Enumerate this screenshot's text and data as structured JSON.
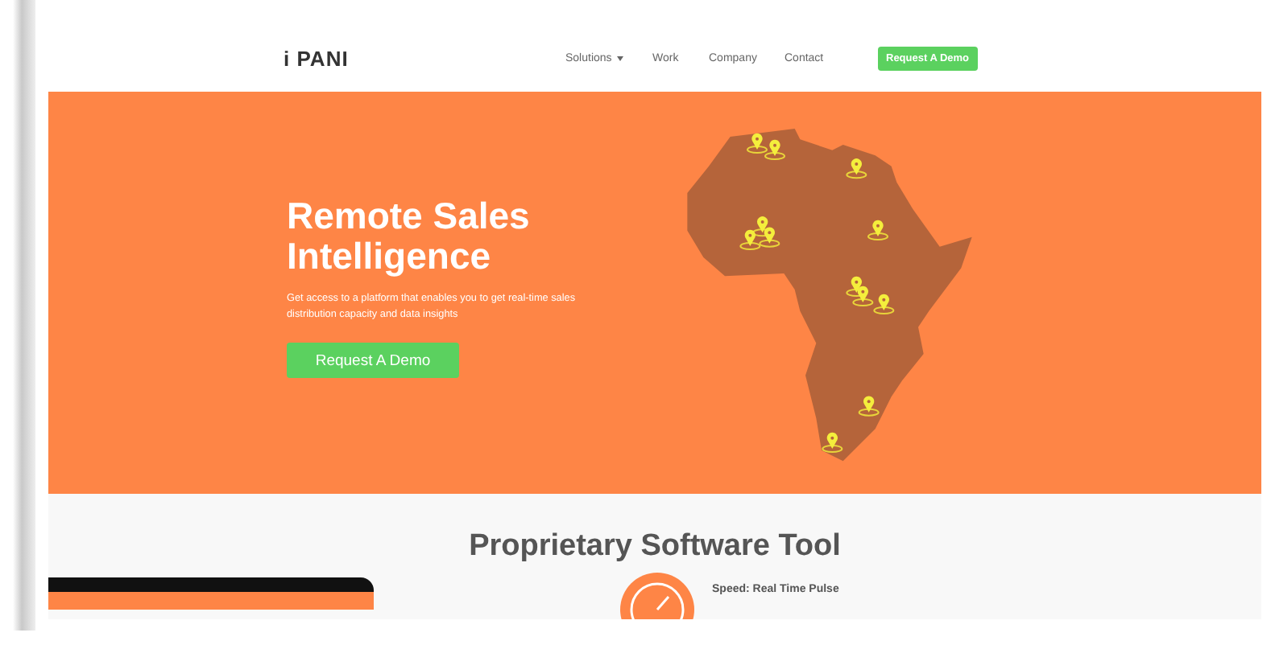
{
  "header": {
    "logo": "i PANI",
    "nav": [
      {
        "label": "Solutions",
        "dropdown": true
      },
      {
        "label": "Work",
        "dropdown": false
      },
      {
        "label": "Company",
        "dropdown": false
      },
      {
        "label": "Contact",
        "dropdown": false
      }
    ],
    "cta": "Request A Demo"
  },
  "hero": {
    "title": "Remote Sales Intelligence",
    "subtitle": "Get access to a platform that enables you to get real-time sales distribution capacity and data insights",
    "button": "Request A Demo"
  },
  "section": {
    "title": "Proprietary Software Tool",
    "feature": "Speed: Real Time Pulse"
  }
}
